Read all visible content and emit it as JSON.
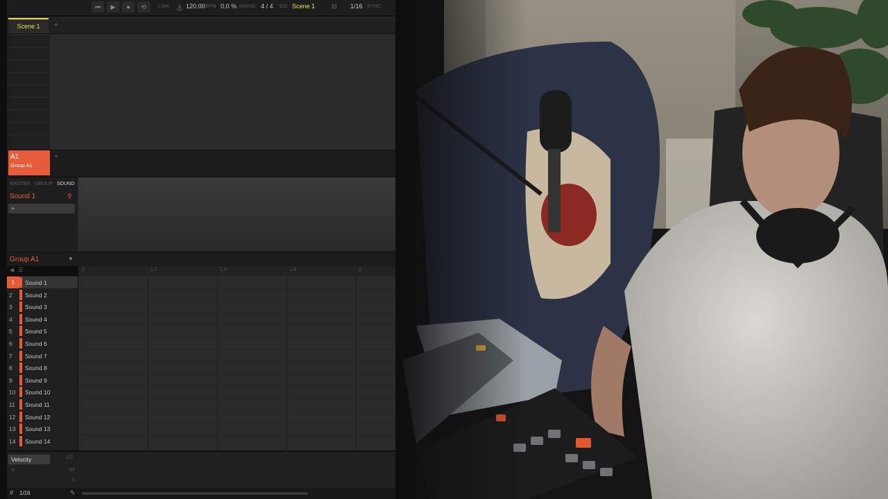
{
  "colors": {
    "accent": "#e85c3a",
    "highlight": "#e8e24a",
    "panel": "#282828"
  },
  "transport": {
    "link": "LINK",
    "tempo": "120.00",
    "tempo_unit": "BPM",
    "swing": "0.0 %",
    "swing_label": "SWING",
    "signature": "4 / 4",
    "signature_label": "SIG",
    "scene": "Scene 1",
    "grid": "1/16",
    "sync": "SYNC"
  },
  "arranger": {
    "scene_tab": "Scene 1",
    "add": "+",
    "group": {
      "short": "A1",
      "name": "Group A1"
    }
  },
  "control": {
    "tabs": [
      "MASTER",
      "GROUP",
      "SOUND"
    ],
    "sound_title": "Sound 1",
    "add": "+"
  },
  "pattern": {
    "group_title": "Group A1",
    "ruler": [
      "1",
      "1.2",
      "1.3",
      "1.4",
      "2"
    ],
    "sounds": [
      {
        "num": "1",
        "name": "Sound 1"
      },
      {
        "num": "2",
        "name": "Sound 2"
      },
      {
        "num": "3",
        "name": "Sound 3"
      },
      {
        "num": "4",
        "name": "Sound 4"
      },
      {
        "num": "5",
        "name": "Sound 5"
      },
      {
        "num": "6",
        "name": "Sound 6"
      },
      {
        "num": "7",
        "name": "Sound 7"
      },
      {
        "num": "8",
        "name": "Sound 8"
      },
      {
        "num": "9",
        "name": "Sound 9"
      },
      {
        "num": "10",
        "name": "Sound 10"
      },
      {
        "num": "11",
        "name": "Sound 11"
      },
      {
        "num": "12",
        "name": "Sound 12"
      },
      {
        "num": "13",
        "name": "Sound 13"
      },
      {
        "num": "14",
        "name": "Sound 14"
      }
    ],
    "velocity": {
      "label": "Velocity",
      "max": "127",
      "mid": "63",
      "min": "0",
      "add": "+"
    },
    "resolution": "1/16"
  },
  "icons": [
    "skip-back-icon",
    "play-icon",
    "record-icon",
    "loop-icon",
    "metronome-icon",
    "search-icon",
    "speaker-icon",
    "grid-icon",
    "pencil-icon",
    "chevron-down-icon"
  ]
}
